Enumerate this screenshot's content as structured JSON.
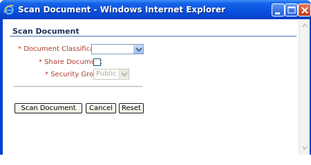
{
  "window": {
    "title": "Scan Document - Windows Internet Explorer",
    "controls": [
      "minimize",
      "maximize",
      "close"
    ]
  },
  "icons": {
    "app": "internet-explorer-icon",
    "minimize": "minimize-icon",
    "maximize": "maximize-icon",
    "close": "close-icon"
  },
  "form": {
    "section_title": "Scan Document",
    "required_marker": "*",
    "fields": {
      "document_classification": {
        "label": "Document Classification",
        "value": ""
      },
      "share_document": {
        "label": "Share Document",
        "checked": false
      },
      "security_group": {
        "label": "Security Group",
        "value": "Public",
        "disabled": true
      }
    },
    "buttons": {
      "scan": "Scan Document",
      "cancel": "Cancel",
      "reset": "Reset"
    }
  },
  "colors": {
    "titlebar": "#0a52e0",
    "label": "#b03a2e",
    "section_rule": "#6f8cbf"
  }
}
